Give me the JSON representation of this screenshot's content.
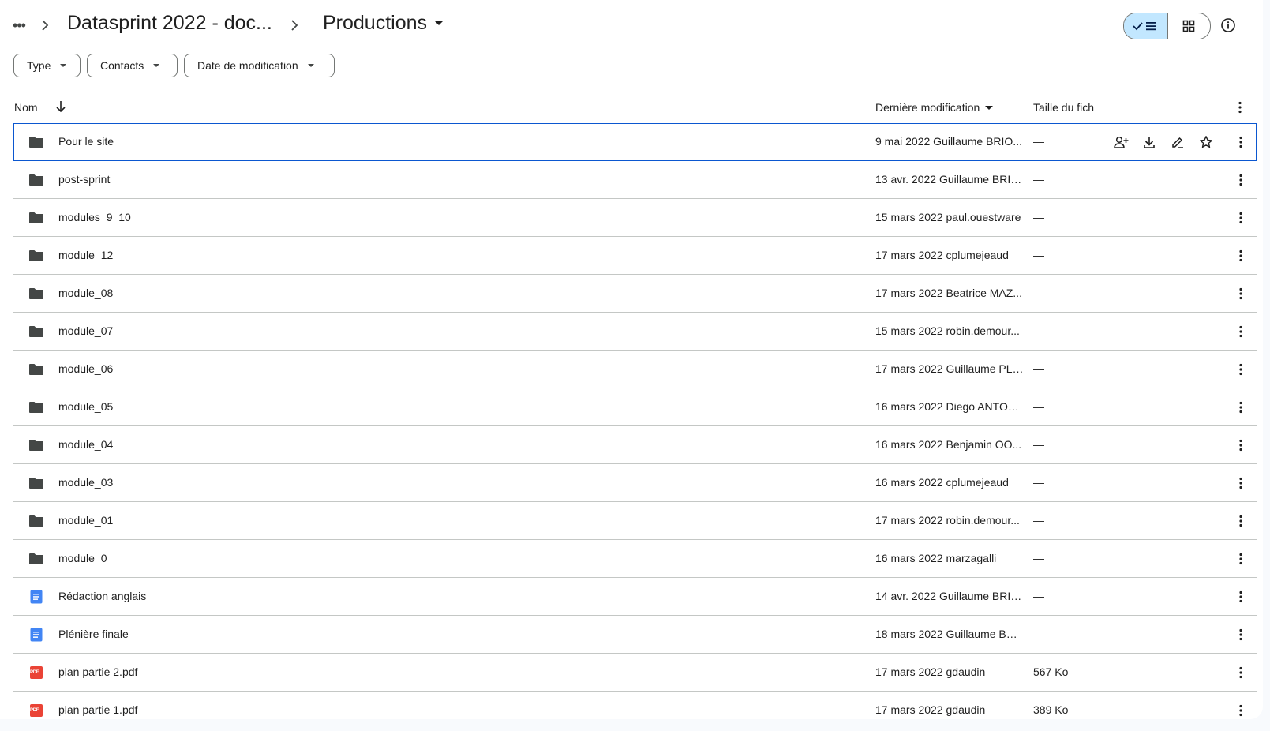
{
  "breadcrumb": {
    "more_label": "•••",
    "parent": "Datasprint 2022 - doc...",
    "current": "Productions"
  },
  "filters": [
    {
      "label": "Type"
    },
    {
      "label": "Contacts"
    },
    {
      "label": "Date de modification"
    }
  ],
  "table": {
    "columns": {
      "name": "Nom",
      "modified": "Dernière modification",
      "size": "Taille du fich"
    },
    "rows": [
      {
        "type": "folder",
        "name": "Pour le site",
        "modified": "9 mai 2022 Guillaume BRIO...",
        "size": "—"
      },
      {
        "type": "folder",
        "name": "post-sprint",
        "modified": "13 avr. 2022 Guillaume BRIO...",
        "size": "—"
      },
      {
        "type": "folder",
        "name": "modules_9_10",
        "modified": "15 mars 2022 paul.ouestware",
        "size": "—"
      },
      {
        "type": "folder",
        "name": "module_12",
        "modified": "17 mars 2022 cplumejeaud",
        "size": "—"
      },
      {
        "type": "folder",
        "name": "module_08",
        "modified": "17 mars 2022 Beatrice MAZ...",
        "size": "—"
      },
      {
        "type": "folder",
        "name": "module_07",
        "modified": "15 mars 2022 robin.demour...",
        "size": "—"
      },
      {
        "type": "folder",
        "name": "module_06",
        "modified": "17 mars 2022 Guillaume PLI...",
        "size": "—"
      },
      {
        "type": "folder",
        "name": "module_05",
        "modified": "16 mars 2022 Diego ANTOLI...",
        "size": "—"
      },
      {
        "type": "folder",
        "name": "module_04",
        "modified": "16 mars 2022 Benjamin OO...",
        "size": "—"
      },
      {
        "type": "folder",
        "name": "module_03",
        "modified": "16 mars 2022 cplumejeaud",
        "size": "—"
      },
      {
        "type": "folder",
        "name": "module_01",
        "modified": "17 mars 2022 robin.demour...",
        "size": "—"
      },
      {
        "type": "folder",
        "name": "module_0",
        "modified": "16 mars 2022 marzagalli",
        "size": "—"
      },
      {
        "type": "doc",
        "name": "Rédaction anglais",
        "modified": "14 avr. 2022 Guillaume BRIO...",
        "size": "—"
      },
      {
        "type": "doc",
        "name": "Plénière finale",
        "modified": "18 mars 2022 Guillaume BRI...",
        "size": "—"
      },
      {
        "type": "pdf",
        "name": "plan partie 2.pdf",
        "modified": "17 mars 2022 gdaudin",
        "size": "567 Ko"
      },
      {
        "type": "pdf",
        "name": "plan partie 1.pdf",
        "modified": "17 mars 2022 gdaudin",
        "size": "389 Ko"
      }
    ]
  },
  "icons": {
    "folder": "folder-icon",
    "doc": "google-doc-icon",
    "pdf": "pdf-icon",
    "pdf_badge": "PDF"
  },
  "colors": {
    "selected_border": "#0b57d0",
    "toggle_active": "#c2e7ff",
    "doc_blue": "#4285f4",
    "pdf_red": "#ea4335",
    "folder_grey": "#444746"
  }
}
